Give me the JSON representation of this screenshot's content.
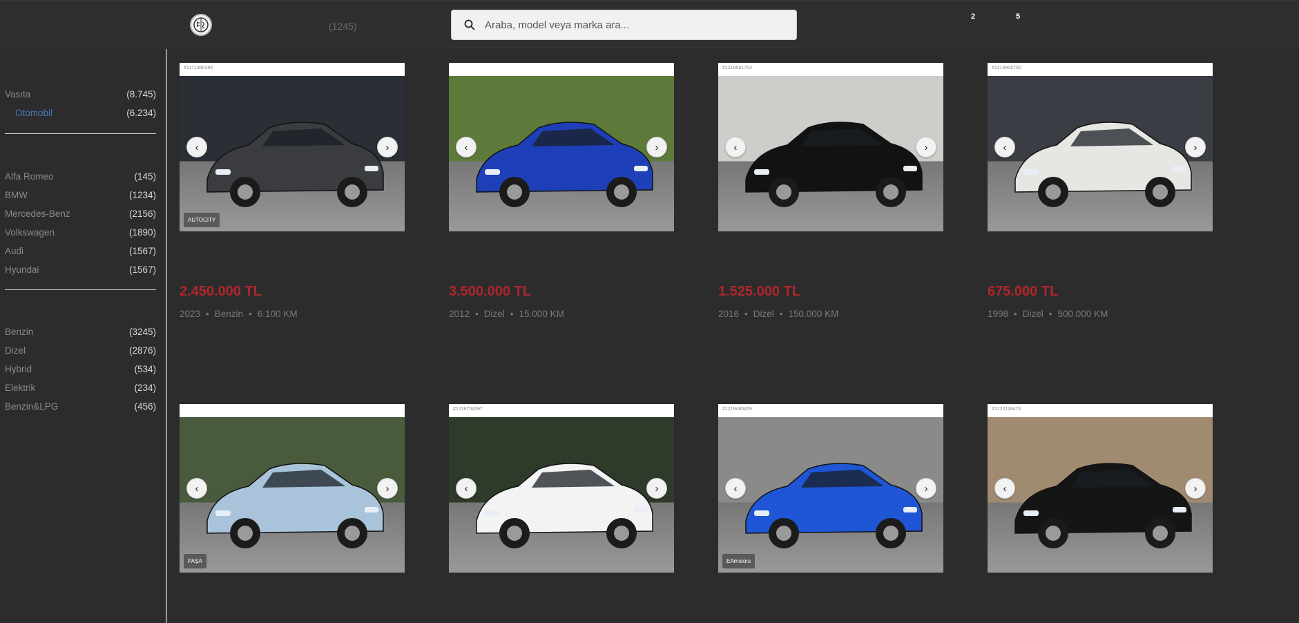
{
  "header": {
    "total_count": "(1245)",
    "search_placeholder": "Araba, model veya marka ara...",
    "badge_1": "2",
    "badge_2": "5"
  },
  "sidebar": {
    "categories": [
      {
        "label": "Vasıta",
        "count": "(8.745)"
      },
      {
        "label": "Otomobil",
        "count": "(6.234)"
      }
    ],
    "brands": [
      {
        "label": "Alfa Romeo",
        "count": "(145)"
      },
      {
        "label": "BMW",
        "count": "(1234)"
      },
      {
        "label": "Mercedes-Benz",
        "count": "(2156)"
      },
      {
        "label": "Volkswagen",
        "count": "(1890)"
      },
      {
        "label": "Audi",
        "count": "(1567)"
      },
      {
        "label": "Hyundai",
        "count": "(1567)"
      }
    ],
    "fuels": [
      {
        "label": "Benzin",
        "count": "(3245)"
      },
      {
        "label": "Dizel",
        "count": "(2876)"
      },
      {
        "label": "Hybrid",
        "count": "(534)"
      },
      {
        "label": "Elektrik",
        "count": "(234)"
      },
      {
        "label": "Benzin&LPG",
        "count": "(456)"
      }
    ]
  },
  "listings": [
    {
      "price": "2.450.000 TL",
      "year": "2023",
      "fuel": "Benzin",
      "km": "6.100 KM",
      "photo_id": "#1171980394",
      "dealer": "AUTOCITY",
      "car_color": "#3a3c40",
      "scene_bg": "#2a2f36"
    },
    {
      "price": "3.500.000 TL",
      "year": "2012",
      "fuel": "Dizel",
      "km": "15.000 KM",
      "photo_id": "",
      "dealer": "",
      "car_color": "#1d3fb8",
      "scene_bg": "#5e7a3a"
    },
    {
      "price": "1.525.000 TL",
      "year": "2016",
      "fuel": "Dizel",
      "km": "150.000 KM",
      "photo_id": "#1219591763",
      "dealer": "",
      "car_color": "#121212",
      "scene_bg": "#cfcdc9"
    },
    {
      "price": "675.000 TL",
      "year": "1998",
      "fuel": "Dizel",
      "km": "500.000 KM",
      "photo_id": "#1219905700",
      "dealer": "",
      "car_color": "#e6e7e2",
      "scene_bg": "#3a3d43"
    },
    {
      "price": "",
      "year": "",
      "fuel": "",
      "km": "",
      "photo_id": "",
      "dealer": "PAŞA",
      "car_color": "#a9c4da",
      "scene_bg": "#4a5a3c"
    },
    {
      "price": "",
      "year": "",
      "fuel": "",
      "km": "",
      "photo_id": "#1216704397",
      "dealer": "",
      "car_color": "#f3f3f3",
      "scene_bg": "#2e3a2a"
    },
    {
      "price": "",
      "year": "",
      "fuel": "",
      "km": "",
      "photo_id": "#1219480459",
      "dealer": "EAmotors",
      "car_color": "#1e56d6",
      "scene_bg": "#8a8a88"
    },
    {
      "price": "",
      "year": "",
      "fuel": "",
      "km": "",
      "photo_id": "#1222118474",
      "dealer": "",
      "car_color": "#151515",
      "scene_bg": "#a08a70"
    }
  ]
}
